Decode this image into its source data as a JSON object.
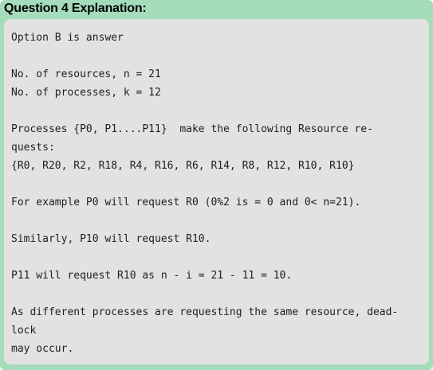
{
  "panel": {
    "title": "Question 4 Explanation:"
  },
  "explanation": {
    "lines": [
      "Option B is answer",
      "",
      "No. of resources, n = 21",
      "No. of processes, k = 12",
      "",
      "Processes {P0, P1....P11}  make the following Resource re-",
      "quests:",
      "{R0, R20, R2, R18, R4, R16, R6, R14, R8, R12, R10, R10}",
      "",
      "For example P0 will request R0 (0%2 is = 0 and 0< n=21).",
      "",
      "Similarly, P10 will request R10.",
      "",
      "P11 will request R10 as n - i = 21 - 11 = 10.",
      "",
      "As different processes are requesting the same resource, dead-",
      "lock",
      "may occur."
    ]
  },
  "colors": {
    "panel_background": "#a5dcbb",
    "content_background": "#e2e2e2",
    "text": "#1f1f1f"
  }
}
